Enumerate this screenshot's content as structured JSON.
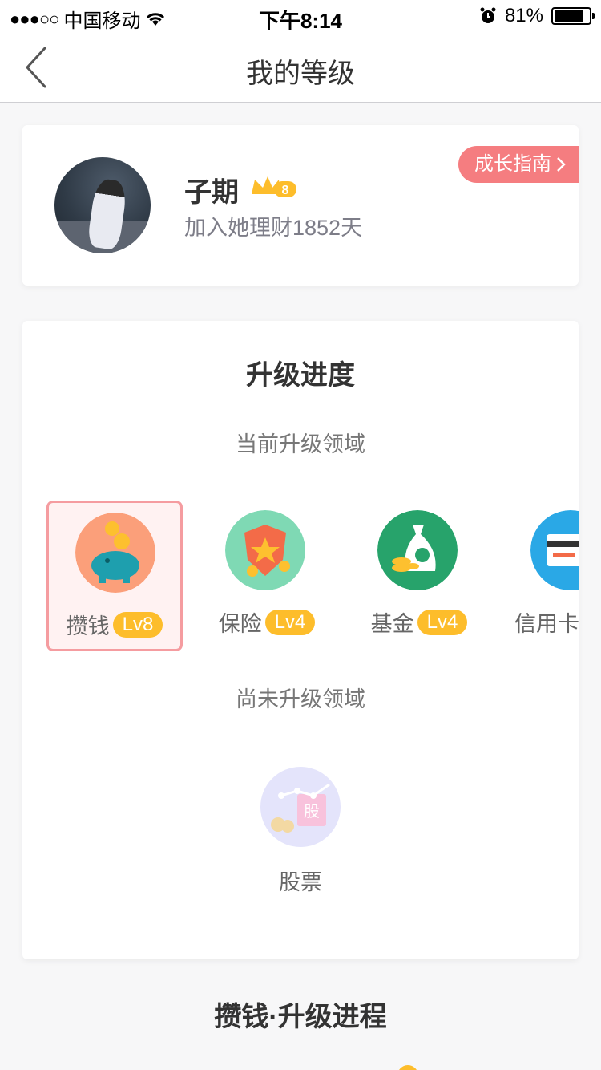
{
  "status_bar": {
    "signal_dots": "●●●○○",
    "carrier": "中国移动",
    "time": "下午8:14",
    "battery_percent": "81%",
    "icons": [
      "wifi-icon",
      "alarm-icon",
      "battery-icon"
    ]
  },
  "nav": {
    "back_icon": "chevron-left-icon",
    "title": "我的等级"
  },
  "profile": {
    "name": "子期",
    "badge_icon": "crown-badge-icon",
    "joined_text": "加入她理财1852天",
    "guide_button": "成长指南",
    "guide_icon": "chevron-right-icon",
    "guide_color": "#f57d80"
  },
  "progress": {
    "title": "升级进度",
    "current_label": "当前升级领域",
    "domains": [
      {
        "name": "攒钱",
        "level": "Lv8",
        "icon": "piggy-bank-icon",
        "active": true
      },
      {
        "name": "保险",
        "level": "Lv4",
        "icon": "shield-icon",
        "active": false
      },
      {
        "name": "基金",
        "level": "Lv4",
        "icon": "money-bag-icon",
        "active": false
      },
      {
        "name": "信用卡",
        "level": "",
        "icon": "credit-card-icon",
        "active": false
      }
    ],
    "pending_label": "尚未升级领域",
    "pending_domains": [
      {
        "name": "股票",
        "icon": "stock-icon",
        "icon_text": "股"
      }
    ]
  },
  "bottom_section": {
    "title": "攒钱·升级进程"
  },
  "colors": {
    "level_badge": "#fdbd2b",
    "active_border": "#f59ca0",
    "active_bg": "#fff2f2"
  }
}
